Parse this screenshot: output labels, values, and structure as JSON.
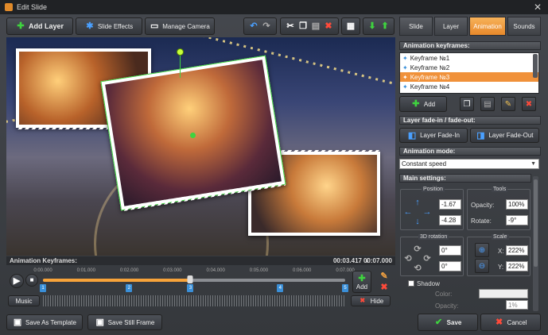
{
  "window": {
    "title": "Edit Slide"
  },
  "toolbar": {
    "add_layer": "Add Layer",
    "slide_effects": "Slide Effects",
    "manage_camera": "Manage Camera"
  },
  "tabs": [
    {
      "label": "Slide"
    },
    {
      "label": "Layer"
    },
    {
      "label": "Animation",
      "active": true
    },
    {
      "label": "Sounds"
    }
  ],
  "animation_keyframes": {
    "heading": "Animation keyframes:",
    "items": [
      "Keyframe №1",
      "Keyframe №2",
      "Keyframe №3",
      "Keyframe №4"
    ],
    "selected_index": 2,
    "add_label": "Add"
  },
  "fade": {
    "heading": "Layer fade-in / fade-out:",
    "fade_in": "Layer Fade-In",
    "fade_out": "Layer Fade-Out"
  },
  "animation_mode": {
    "heading": "Animation mode:",
    "value": "Constant speed"
  },
  "main_settings": {
    "heading": "Main settings:",
    "position_title": "Position",
    "tools_title": "Tools",
    "position_x": "-1.67",
    "position_y": "-4.28",
    "opacity_label": "Opacity:",
    "opacity_value": "100%",
    "rotate_label": "Rotate:",
    "rotate_value": "-9°",
    "rotation3d_title": "3D rotation",
    "rot_a": "0°",
    "rot_b": "0°",
    "scale_title": "Scale",
    "scale_x_label": "X:",
    "scale_x": "222%",
    "scale_y_label": "Y:",
    "scale_y": "222%",
    "shadow_label": "Shadow",
    "color_label": "Color:",
    "opacity2_label": "Opacity:",
    "opacity2_value": "1%"
  },
  "timeline": {
    "heading": "Animation Keyframes:",
    "time_current": "00:03.417",
    "time_total": "00:07.000",
    "ticks": [
      "0:00.000",
      "0:01.000",
      "0:02.000",
      "0:03.000",
      "0:04.000",
      "0:05.000",
      "0:06.000",
      "0:07.000"
    ],
    "keyframe_marks": [
      "1",
      "2",
      "3",
      "4",
      "5"
    ],
    "progress_fraction": 0.488,
    "add_label": "Add",
    "music_label": "Music",
    "hide_label": "Hide"
  },
  "bottom": {
    "save_template": "Save As Template",
    "save_still": "Save Still Frame",
    "save": "Save",
    "cancel": "Cancel"
  }
}
